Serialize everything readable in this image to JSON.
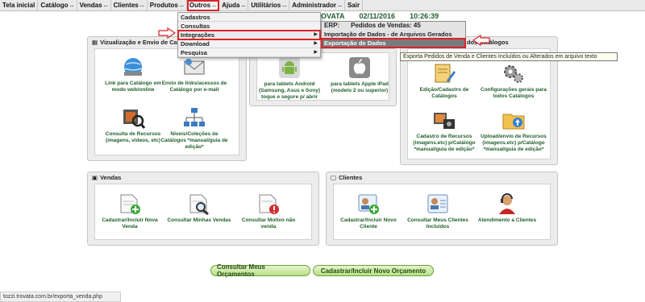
{
  "menubar": {
    "items": [
      {
        "label": "Tela inicial",
        "dots": ""
      },
      {
        "label": "Catálogo",
        "dots": "..."
      },
      {
        "label": "Vendas",
        "dots": "..."
      },
      {
        "label": "Clientes",
        "dots": "..."
      },
      {
        "label": "Produtos",
        "dots": "..."
      },
      {
        "label": "Outros",
        "dots": "..."
      },
      {
        "label": "Ajuda",
        "dots": "..."
      },
      {
        "label": "Utilitários",
        "dots": "..."
      },
      {
        "label": "Administrador",
        "dots": "..."
      },
      {
        "label": "Sair",
        "dots": ""
      }
    ]
  },
  "infobar": {
    "brand": "OVATA",
    "date": "02/11/2016",
    "time": "10:26:39"
  },
  "dropdown": {
    "items": [
      {
        "label": "Cadastros",
        "arrow": ""
      },
      {
        "label": "Consultas",
        "arrow": ""
      },
      {
        "label": "Integrações",
        "arrow": "▶"
      },
      {
        "label": "Download",
        "arrow": "▶"
      },
      {
        "label": "Pesquisa",
        "arrow": "▶"
      }
    ]
  },
  "submenu": {
    "erp": "ERP:",
    "pedidos": "Pedidos de Vendas: 45",
    "items": [
      {
        "label": "Importação de Dados - de Arquivos Gerados"
      },
      {
        "label": "Exportação de Dados"
      }
    ]
  },
  "tooltip": {
    "text": "Exporta Pedidos de Venda e Clientes Incluídos ou Alterados em arquivo texto"
  },
  "panels": {
    "catalog_view": {
      "title": "Vizualização e Envio de Cata",
      "tiles": [
        {
          "label": "Link para Catálogo em modo web/online"
        },
        {
          "label": "Envio de links/acessos de Catálogo por e-mail"
        },
        {
          "label": "Consulta de Recursos (imagens, vídeos, etc)"
        },
        {
          "label": "Níveis/Coleções de Catálogos *manual/guia de edição*"
        }
      ]
    },
    "tablets": {
      "tiles": [
        {
          "label": "para tablets Android (Samsung, Asus e Sony) toque e segure p/ abrir"
        },
        {
          "label": "para tablets Apple iPad (modelo 2 ou superior)"
        }
      ]
    },
    "catalog_admin": {
      "title": "dos Catálogos",
      "tiles": [
        {
          "label": "Edição/Cadastro de Catálogos"
        },
        {
          "label": "Configurações gerais para todos Catálogos"
        },
        {
          "label": "Cadastro de Recursos (imagens.etc) p/Catálogo *manual/guia de edição*"
        },
        {
          "label": "Upload/envio de Recursos (imagens.etc) p/Catálogo *manual/guia de edição*"
        }
      ]
    },
    "vendas": {
      "title": "Vendas",
      "tiles": [
        {
          "label": "Cadastrar/Incluir Nova Venda"
        },
        {
          "label": "Consultar Minhas Vendas"
        },
        {
          "label": "Consultar Motivo não venda"
        }
      ]
    },
    "clientes": {
      "title": "Clientes",
      "tiles": [
        {
          "label": "Cadastrar/Incluir Novo Cliente"
        },
        {
          "label": "Consultar Meus Clientes Incluídos"
        },
        {
          "label": "Atendimento a Clientes"
        }
      ]
    }
  },
  "buttons": {
    "consultar_orcamentos": "Consultar Meus Orçamentos",
    "novo_orcamento": "Cadastrar/Incluir Novo Orçamento"
  },
  "statusbar": {
    "url": "tozzi.trovata.com.br/exporta_venda.php"
  }
}
